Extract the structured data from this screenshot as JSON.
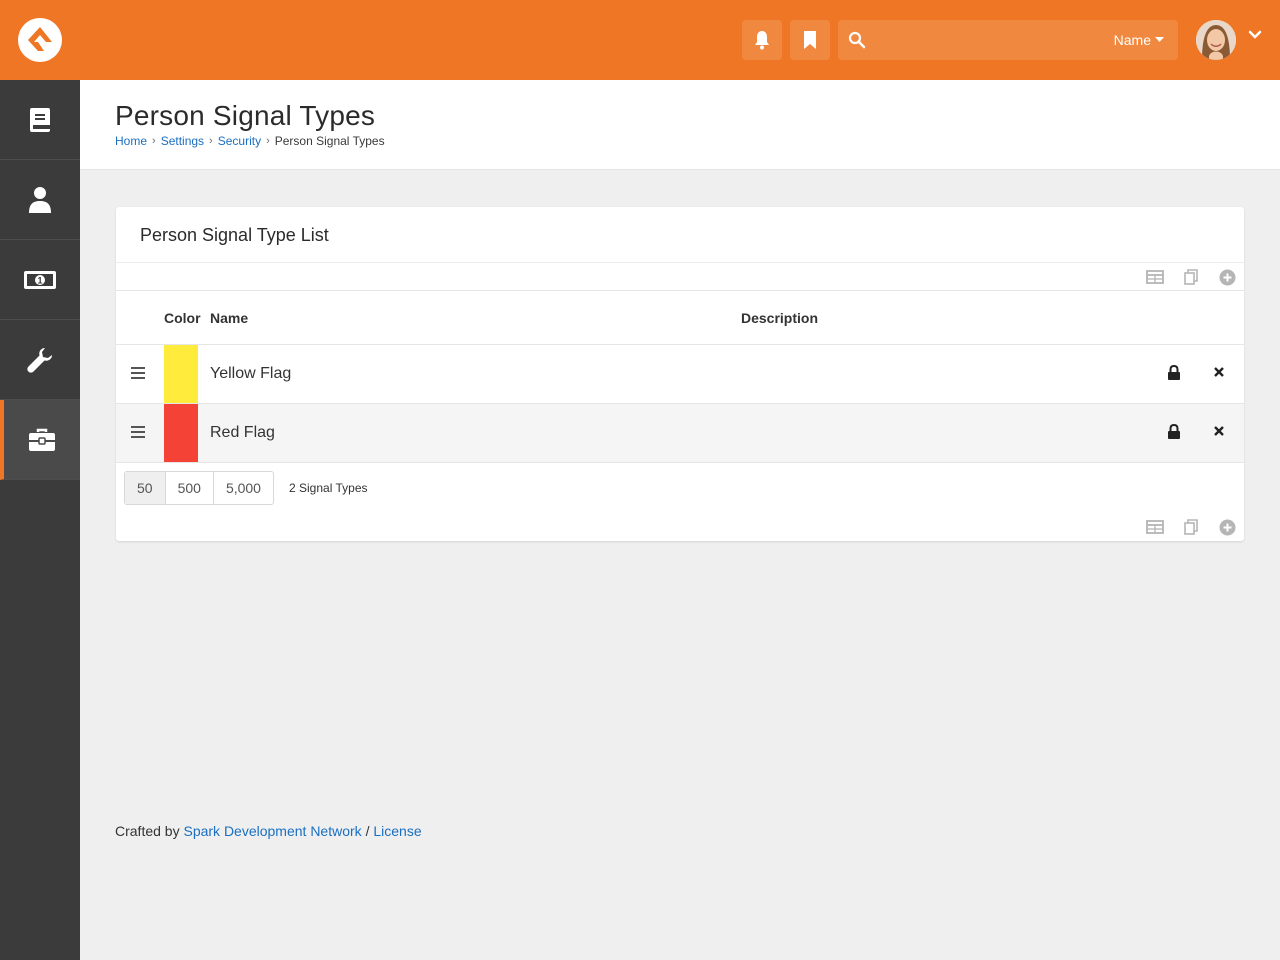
{
  "header": {
    "search": {
      "placeholder": "",
      "scope_label": "Name"
    },
    "icons": [
      "bell-icon",
      "bookmark-icon",
      "search-icon",
      "caret-down-icon",
      "chevron-down-icon"
    ],
    "accent_color": "#ee7624"
  },
  "sidebar": {
    "items": [
      {
        "icon": "book-icon"
      },
      {
        "icon": "person-icon"
      },
      {
        "icon": "money-icon"
      },
      {
        "icon": "wrench-icon"
      },
      {
        "icon": "briefcase-icon",
        "active": true
      }
    ]
  },
  "page": {
    "title": "Person Signal Types",
    "breadcrumb": [
      {
        "label": "Home"
      },
      {
        "label": "Settings"
      },
      {
        "label": "Security"
      },
      {
        "label": "Person Signal Types"
      }
    ]
  },
  "panel": {
    "title": "Person Signal Type List",
    "columns": {
      "color": "Color",
      "name": "Name",
      "description": "Description"
    },
    "rows": [
      {
        "color": "#ffeb3b",
        "name": "Yellow Flag",
        "description": ""
      },
      {
        "color": "#f44336",
        "name": "Red Flag",
        "description": ""
      }
    ],
    "pager": {
      "sizes": [
        "50",
        "500",
        "5,000"
      ],
      "active": "50"
    },
    "item_count": "2 Signal Types"
  },
  "footer": {
    "prefix": "Crafted by",
    "org_link": "Spark Development Network",
    "separator": "/",
    "license_link": "License"
  }
}
